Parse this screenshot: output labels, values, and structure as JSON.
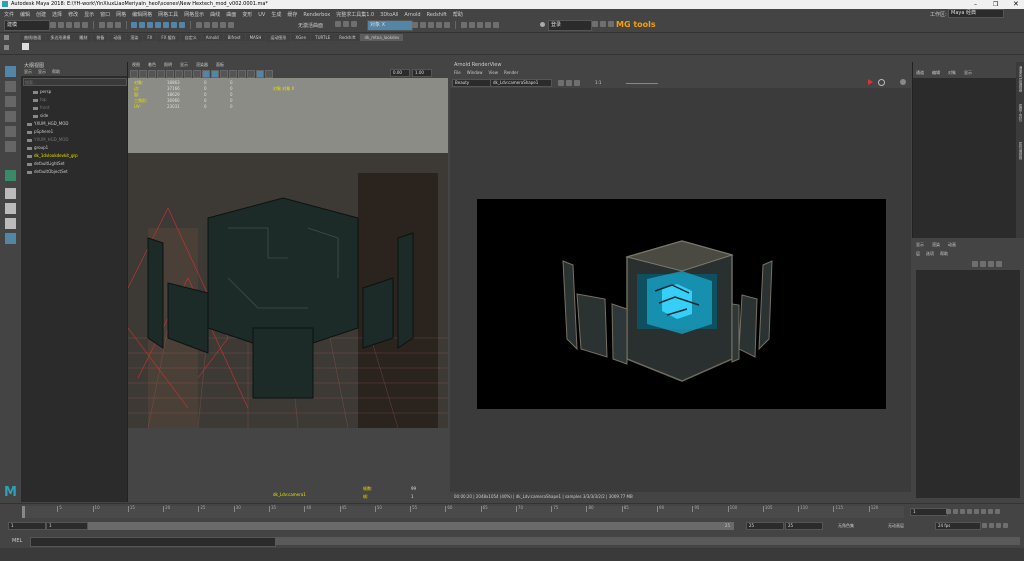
{
  "titlebar": {
    "title": "Autodesk Maya 2018: E:\\YH-work\\YinXiuxLiaoMeriyaln_heol\\scenes\\New Hextech_mod_v002.0001.ma*"
  },
  "menubar": {
    "items": [
      "文件",
      "编辑",
      "创建",
      "选择",
      "修改",
      "显示",
      "窗口",
      "网格",
      "编辑网格",
      "网格工具",
      "网格显示",
      "曲线",
      "曲面",
      "变形",
      "UV",
      "生成",
      "缓存",
      "Renderbox",
      "完整求工具集1.0",
      "3DtoAll",
      "Arnold",
      "Redshift",
      "帮助"
    ],
    "workspace_label": "工作区:",
    "workspace_value": "Maya 经典"
  },
  "status": {
    "mode": "建模",
    "no_live": "无激活曲面",
    "symmetry": "对象 X",
    "login": "登录",
    "logo": "MG tools"
  },
  "shelf": {
    "tabs": [
      "曲线/曲面",
      "多边形建模",
      "雕刻",
      "装备",
      "动画",
      "渲染",
      "FX",
      "FX 缓存",
      "自定义",
      "Arnold",
      "Bifrost",
      "MASH",
      "运动图形",
      "XGen",
      "TURTLE",
      "Redshift",
      "dk_mtoa_lookdev"
    ]
  },
  "outliner": {
    "title": "大纲视图",
    "menu": [
      "显示",
      "显示",
      "帮助"
    ],
    "search_placeholder": "搜索...",
    "items": [
      "persp",
      "top",
      "front",
      "side",
      "YXUM_HGD_MOD",
      "pSphere1",
      "YXUM_HGD_MOD",
      "group1",
      "dk_1dvlookdevkit_grp",
      "defaultLightSet",
      "defaultObjectSet"
    ]
  },
  "viewport": {
    "menu": [
      "视图",
      "着色",
      "照明",
      "显示",
      "渲染器",
      "面板"
    ],
    "hud_labels": [
      "对象:",
      "边:",
      "面:",
      "三角形:",
      "UV:"
    ],
    "hud_col1": [
      "18863",
      "37166",
      "18629",
      "36966",
      "23031"
    ],
    "hud_col2": [
      "0",
      "0",
      "0",
      "0",
      "0"
    ],
    "hud_col3": [
      "0",
      "0",
      "0",
      "0",
      "0"
    ],
    "top_field1": "0.00",
    "top_field2": "1.00",
    "top_note": "对象 对象 X",
    "camera": "dk_Ldv:camera1",
    "bottom_labels": [
      "帧数:",
      "帧:"
    ],
    "bottom_values": [
      "99",
      "1"
    ]
  },
  "renderview": {
    "title": "Arnold RenderView",
    "menu": [
      "File",
      "Window",
      "View",
      "Render"
    ],
    "aov": "Beauty",
    "camera": "dk_Ldv:cameraShape1",
    "ratio": "1:1",
    "status": "00:00:20 | 2048x1054 (40%) | dk_Ldv:cameraShape1 | samples 3/3/3/3/2/2 | 3009.77 MB"
  },
  "channelbox": {
    "tabs": [
      "通道",
      "编辑",
      "对象",
      "显示"
    ],
    "side_tabs": [
      "通道盒/层编辑器",
      "建模工具包",
      "属性编辑器"
    ]
  },
  "layers": {
    "tabs": [
      "显示",
      "渲染",
      "动画"
    ],
    "menu": [
      "层",
      "选项",
      "帮助"
    ]
  },
  "timeline": {
    "ticks": [
      "5",
      "10",
      "15",
      "20",
      "25",
      "30",
      "35",
      "40",
      "45",
      "50",
      "55",
      "60",
      "65",
      "70",
      "75",
      "80",
      "85",
      "90",
      "95",
      "100",
      "105",
      "110",
      "115",
      "120"
    ],
    "current_frame": "1"
  },
  "range": {
    "start": "1",
    "start2": "1",
    "range_end": "25",
    "end1": "25",
    "end2": "25",
    "char_set": "无角色集",
    "anim_layer": "无动画层",
    "fps": "24 fps"
  },
  "command": {
    "label": "MEL"
  },
  "colors": {
    "bg": "#444444",
    "panel": "#2b2b2b",
    "highlight": "#5285a6",
    "yellow": "#e8e000",
    "glow": "#35d0ff"
  }
}
